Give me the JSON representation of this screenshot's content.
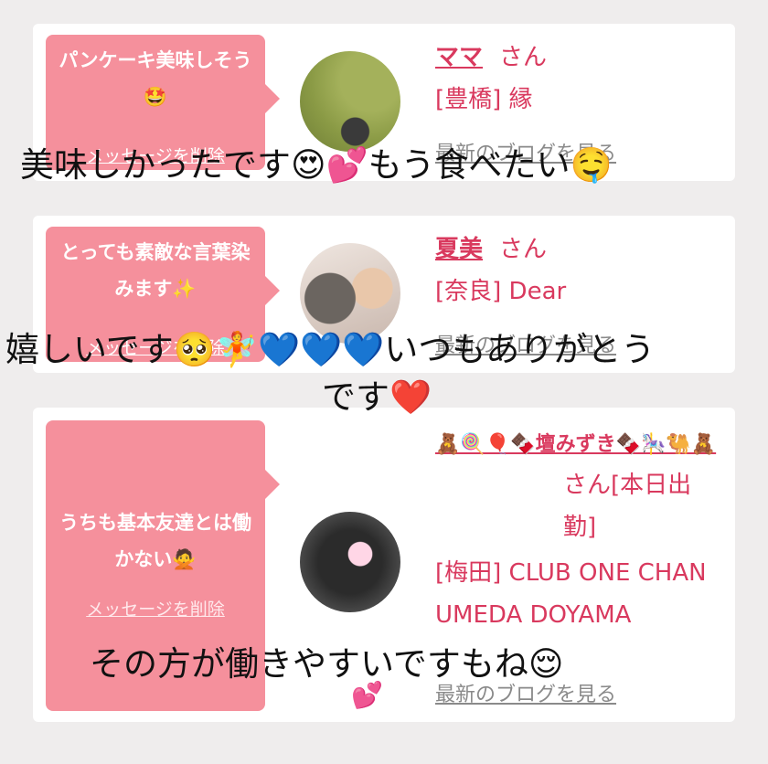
{
  "cards": [
    {
      "message": "パンケーキ美味しそう🤩",
      "delete_label": "メッセージを削除",
      "name": "ママ",
      "honorific": "さん",
      "shop": "[豊橋] 縁",
      "blog_label": "最新のブログを見る"
    },
    {
      "message": "とっても素敵な言葉染みます✨",
      "delete_label": "メッセージを削除",
      "name": "夏美",
      "honorific": "さん",
      "shop": "[奈良] Dear",
      "blog_label": "最新のブログを見る"
    },
    {
      "message": "うちも基本友達とは働かない🙅",
      "delete_label": "メッセージを削除",
      "name": "🧸🍭🎈🍫壇みずき🍫🎠🐫🧸",
      "honorific": "さん[本日出勤]",
      "shop": "[梅田] CLUB ONE CHAN UMEDA DOYAMA",
      "blog_label": "最新のブログを見る"
    }
  ],
  "overlays": {
    "line1": "美味しかったです😍💕もう食べたい🤤",
    "line2": "嬉しいです🥺🧚💙💙💙いつもありがとう",
    "line3": "です❤️",
    "line4": "その方が働きやすいですもね😌",
    "line5": "💕"
  }
}
